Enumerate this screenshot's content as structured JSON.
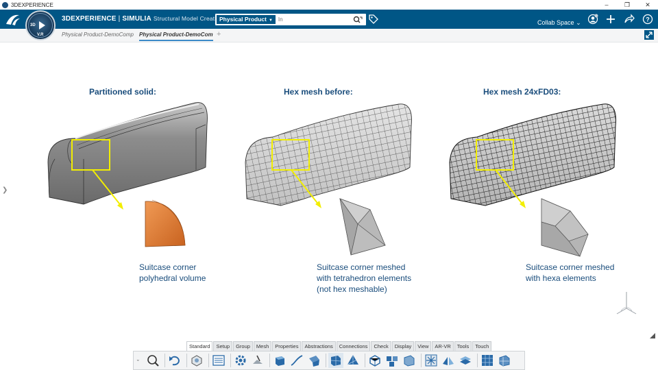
{
  "window": {
    "title": "3DEXPERIENCE",
    "controls": [
      "–",
      "❐",
      "✕"
    ]
  },
  "topbar": {
    "compass_label": "3D",
    "compass_version": "V.R",
    "brand_main": "3DEXPERIENCE",
    "brand_sep": " | ",
    "brand_product": "SIMULIA",
    "brand_app": "Structural Model Creation",
    "search_scope": "Physical Product",
    "search_placeholder": "In",
    "collab_space": "Collab Space"
  },
  "tabs": [
    {
      "label": "Physical Product-DemoComp"
    },
    {
      "label": "Physical Product-DemoCom"
    }
  ],
  "tab_add": "+",
  "panels": [
    {
      "heading": "Partitioned solid:",
      "caption": [
        "Suitcase corner",
        "polyhedral volume"
      ]
    },
    {
      "heading": "Hex mesh before:",
      "caption": [
        "Suitcase corner meshed",
        "with tetrahedron elements",
        "(not hex meshable)"
      ]
    },
    {
      "heading": "Hex mesh 24xFD03:",
      "caption": [
        "Suitcase corner meshed",
        "with hexa elements"
      ]
    }
  ],
  "section_tabs": [
    "Standard",
    "Setup",
    "Group",
    "Mesh",
    "Properties",
    "Abstractions",
    "Connections",
    "Check",
    "Display",
    "View",
    "AR-VR",
    "Tools",
    "Touch"
  ],
  "active_section": "Standard",
  "colors": {
    "topbar": "#005686",
    "heading_text": "#1a4d7c",
    "highlight_box": "#f2ee00",
    "corner_solid": "#e07a30",
    "mesh_gray": "#9a9a9a"
  },
  "icons": [
    "ds-logo-icon",
    "search-icon",
    "tag-icon",
    "user-icon",
    "add-icon",
    "share-icon",
    "help-icon",
    "expand-icon",
    "chevron-right-icon"
  ]
}
